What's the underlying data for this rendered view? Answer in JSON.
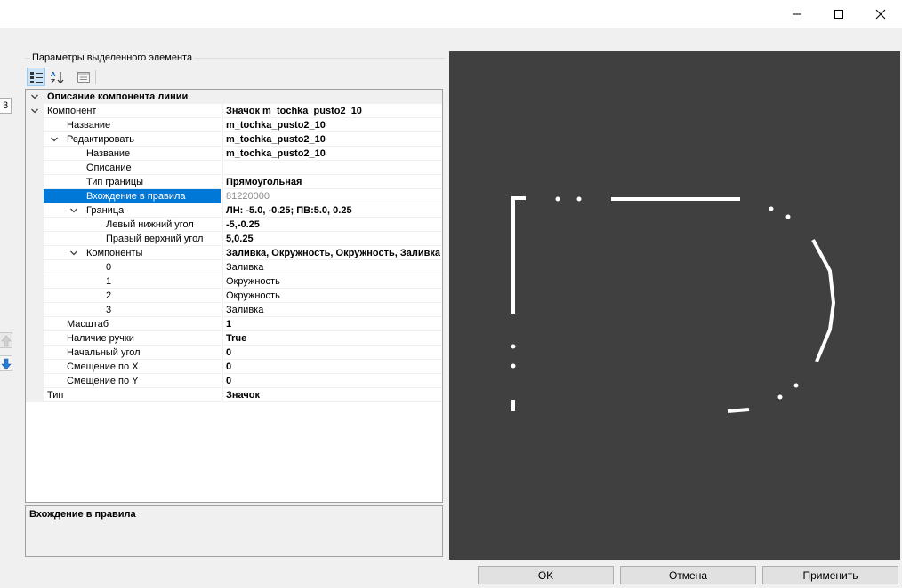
{
  "window": {
    "minimize_icon": "minimize-icon",
    "maximize_icon": "maximize-icon",
    "close_icon": "close-icon"
  },
  "left_strip": {
    "box_value": "3",
    "up_icon": "arrow-up-icon",
    "down_icon": "arrow-down-icon"
  },
  "group": {
    "title": "Параметры выделенного элемента"
  },
  "toolbar": {
    "icons": [
      "categorized-icon",
      "alphabetical-sort-icon",
      "property-pages-icon"
    ]
  },
  "grid": {
    "rows": [
      {
        "type": "category",
        "indent": 0,
        "expanded": true,
        "name": "Описание компонента линии",
        "value": "",
        "bold": false
      },
      {
        "indent": 0,
        "expander": "expanded",
        "name": "Компонент",
        "value": "Значок m_tochka_pusto2_10",
        "bold": true
      },
      {
        "indent": 1,
        "name": "Название",
        "value": "m_tochka_pusto2_10",
        "bold": true
      },
      {
        "indent": 1,
        "expander": "expanded",
        "name": "Редактировать",
        "value": "m_tochka_pusto2_10",
        "bold": true
      },
      {
        "indent": 2,
        "name": "Название",
        "value": "m_tochka_pusto2_10",
        "bold": true
      },
      {
        "indent": 2,
        "name": "Описание",
        "value": "",
        "bold": false
      },
      {
        "indent": 2,
        "name": "Тип границы",
        "value": "Прямоугольная",
        "bold": true
      },
      {
        "indent": 2,
        "name": "Вхождение в правила",
        "value": "81220000",
        "bold": false,
        "selected": true,
        "gray": true
      },
      {
        "indent": 2,
        "expander": "expanded",
        "name": "Граница",
        "value": "ЛН: -5.0, -0.25; ПВ:5.0, 0.25",
        "bold": true
      },
      {
        "indent": 3,
        "name": "Левый нижний угол",
        "value": "-5,-0.25",
        "bold": true
      },
      {
        "indent": 3,
        "name": "Правый верхний угол",
        "value": "5,0.25",
        "bold": true
      },
      {
        "indent": 2,
        "expander": "expanded",
        "name": "Компоненты",
        "value": "Заливка, Окружность, Окружность, Заливка",
        "bold": true
      },
      {
        "indent": 3,
        "name": "0",
        "value": "Заливка",
        "bold": false
      },
      {
        "indent": 3,
        "name": "1",
        "value": "Окружность",
        "bold": false
      },
      {
        "indent": 3,
        "name": "2",
        "value": "Окружность",
        "bold": false
      },
      {
        "indent": 3,
        "name": "3",
        "value": "Заливка",
        "bold": false
      },
      {
        "indent": 1,
        "name": "Масштаб",
        "value": "1",
        "bold": true
      },
      {
        "indent": 1,
        "name": "Наличие ручки",
        "value": "True",
        "bold": true
      },
      {
        "indent": 1,
        "name": "Начальный угол",
        "value": "0",
        "bold": true
      },
      {
        "indent": 1,
        "name": "Смещение по X",
        "value": "0",
        "bold": true
      },
      {
        "indent": 1,
        "name": "Смещение по Y",
        "value": "0",
        "bold": true
      },
      {
        "indent": 0,
        "name": "Тип",
        "value": "Значок",
        "bold": true
      }
    ]
  },
  "description": {
    "title": "Вхождение в правила"
  },
  "buttons": {
    "ok": "OK",
    "cancel": "Отмена",
    "apply": "Применить"
  },
  "colors": {
    "selection": "#0078d7",
    "preview_bg": "#404040",
    "preview_stroke": "#ffffff"
  }
}
